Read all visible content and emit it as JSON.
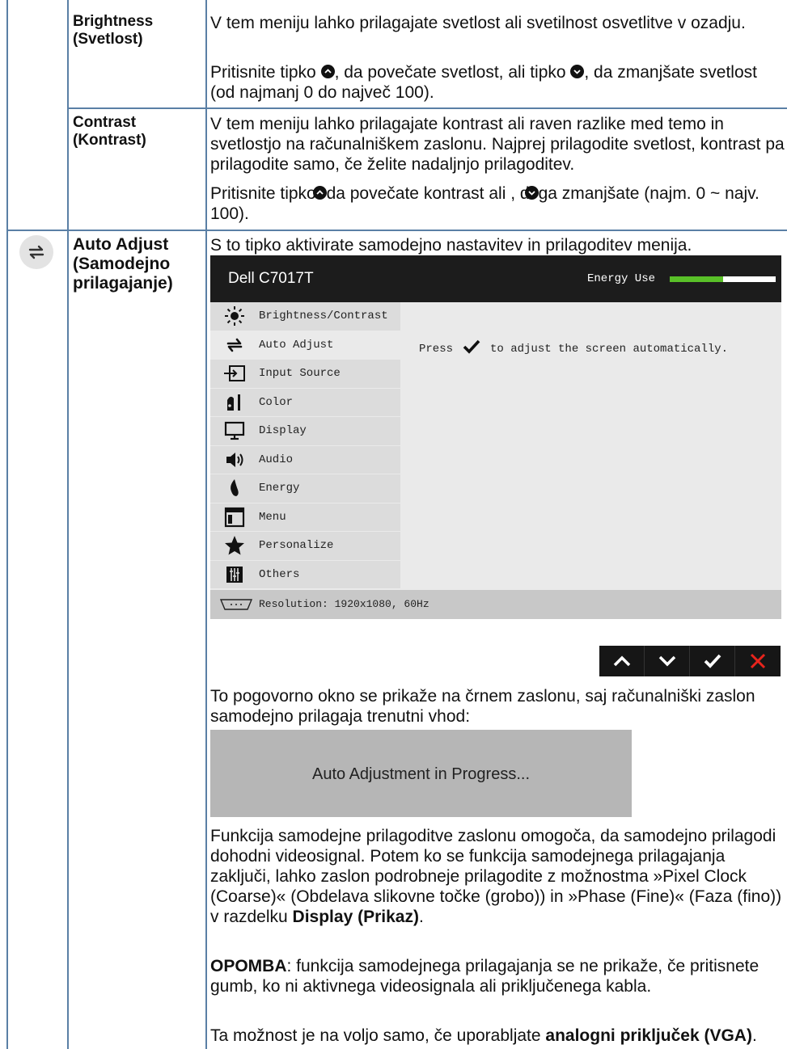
{
  "table": {
    "rows": [
      {
        "term": "Brightness (Svetlost)",
        "term_line1": "Brightness",
        "term_line2": "(Svetlost)",
        "p1": "V tem meniju lahko prilagajate svetlost ali svetilnost osvetlitve v ozadju.",
        "p2_part1": "Pritisnite tipko ",
        "p2_part2": ", da povečate svetlost, ali tipko ",
        "p2_part3": ", da zmanjšate svetlost (od najmanj 0 do največ 100)."
      },
      {
        "term_line1": "Contrast",
        "term_line2": "(Kontrast)",
        "p1": "V tem meniju lahko prilagajate kontrast ali raven razlike med temo in svetlostjo na računalniškem zaslonu. Najprej prilagodite svetlost, kontrast pa prilagodite samo, če želite nadaljnjo prilagoditev.",
        "p2_part1": "Pritisnite tipko ",
        "p2_part2": "da povečate kontrast ali , d",
        "p2_part3": "ga zmanjšate (najm. 0 ~ najv. 100)."
      },
      {
        "icon": "auto-adjust-icon",
        "term_line1": "Auto Adjust",
        "term_line2": "(Samodejno",
        "term_line3": "prilagajanje)",
        "intro": "S to tipko aktivirate samodejno nastavitev in prilagoditev menija.",
        "after_osd": "To pogovorno okno se prikaže na črnem zaslonu, saj računalniški zaslon samodejno prilagaja trenutni vhod:",
        "progress_box": "Auto Adjustment in Progress...",
        "para_func_part1": "Funkcija samodejne prilagoditve zaslonu omogoča, da samodejno prilagodi dohodni videosignal. Potem ko se funkcija samodejnega prilagajanja zaključi, lahko zaslon podrobneje prilagodite z možnostma »Pixel Clock (Coarse)« (Obdelava slikovne točke (grobo)) in »Phase (Fine)« (Faza (fino)) v razdelku ",
        "para_func_bold": "Display (Prikaz)",
        "para_func_part2": ".",
        "note_bold": "OPOMBA",
        "note_text": ": funkcija samodejnega prilagajanja se ne prikaže, če pritisnete gumb, ko ni aktivnega videosignala ali priključenega kabla.",
        "vga_part1": "Ta možnost je na voljo samo, če uporabljate ",
        "vga_bold": "analogni priključek (VGA)",
        "vga_part2": "."
      }
    ]
  },
  "osd": {
    "model": "Dell C7017T",
    "energy_label": "Energy Use",
    "energy_level": 0.5,
    "energy_color": "#59c028",
    "menu": [
      {
        "icon": "brightness-icon",
        "label": "Brightness/Contrast",
        "active": false
      },
      {
        "icon": "auto-adjust-icon",
        "label": "Auto Adjust",
        "active": true
      },
      {
        "icon": "input-source-icon",
        "label": "Input Source",
        "active": false
      },
      {
        "icon": "color-icon",
        "label": "Color",
        "active": false
      },
      {
        "icon": "display-icon",
        "label": "Display",
        "active": false
      },
      {
        "icon": "audio-icon",
        "label": "Audio",
        "active": false
      },
      {
        "icon": "energy-icon",
        "label": "Energy",
        "active": false
      },
      {
        "icon": "menu-icon",
        "label": "Menu",
        "active": false
      },
      {
        "icon": "personalize-icon",
        "label": "Personalize",
        "active": false
      },
      {
        "icon": "others-icon",
        "label": "Others",
        "active": false
      }
    ],
    "message_part1": "Press",
    "message_part2": "to adjust the screen automatically.",
    "resolution": "Resolution: 1920x1080, 60Hz",
    "nav_buttons": [
      "up-icon",
      "down-icon",
      "check-icon",
      "close-icon"
    ]
  }
}
